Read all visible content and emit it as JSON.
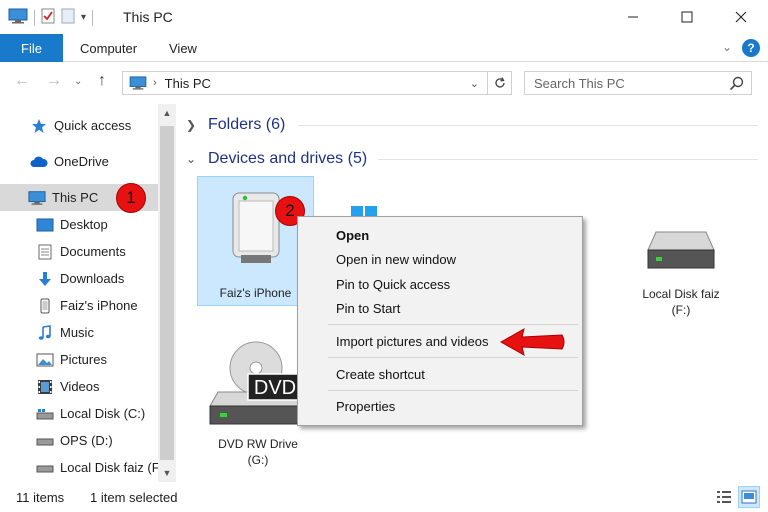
{
  "window": {
    "title": "This PC",
    "minimize": "—",
    "maximize": "☐",
    "close": "✕"
  },
  "ribbon": {
    "tabs": [
      "File",
      "Computer",
      "View"
    ],
    "help": "?"
  },
  "address_bar": {
    "back": "←",
    "forward": "→",
    "up": "↑",
    "path": "This PC",
    "search_placeholder": "Search This PC"
  },
  "nav_pane": {
    "items": [
      {
        "label": "Quick access",
        "icon": "star-icon"
      },
      {
        "label": "OneDrive",
        "icon": "cloud-icon"
      },
      {
        "label": "This PC",
        "icon": "computer-icon"
      },
      {
        "label": "Desktop",
        "icon": "desktop-icon"
      },
      {
        "label": "Documents",
        "icon": "documents-icon"
      },
      {
        "label": "Downloads",
        "icon": "download-icon"
      },
      {
        "label": "Faiz's iPhone",
        "icon": "phone-icon"
      },
      {
        "label": "Music",
        "icon": "music-icon"
      },
      {
        "label": "Pictures",
        "icon": "pictures-icon"
      },
      {
        "label": "Videos",
        "icon": "videos-icon"
      },
      {
        "label": "Local Disk (C:)",
        "icon": "drive-icon"
      },
      {
        "label": "OPS (D:)",
        "icon": "drive-icon"
      },
      {
        "label": "Local Disk faiz (F:",
        "icon": "drive-icon"
      }
    ],
    "selected": "This PC"
  },
  "content": {
    "groups": [
      {
        "label": "Folders (6)",
        "expanded": false
      },
      {
        "label": "Devices and drives (5)",
        "expanded": true
      }
    ],
    "devices": [
      {
        "line1": "Faiz's iPhone",
        "line2": "",
        "selected": true
      },
      {
        "line1": "Local Disk faiz",
        "line2": "(F:)",
        "selected": false
      },
      {
        "line1": "DVD RW Drive",
        "line2": "(G:)",
        "selected": false
      }
    ],
    "dvd_badge": "DVD"
  },
  "context_menu": {
    "items": [
      "Open",
      "Open in new window",
      "Pin to Quick access",
      "Pin to Start",
      "Import pictures and videos",
      "Create shortcut",
      "Properties"
    ]
  },
  "annotations": {
    "step1": "1",
    "step2": "2",
    "arrow_color": "#e81111"
  },
  "status_bar": {
    "item_count": "11 items",
    "selection": "1 item selected"
  },
  "colors": {
    "accent": "#1979ca",
    "selection": "#cce8ff",
    "group_header": "#1e3287"
  }
}
